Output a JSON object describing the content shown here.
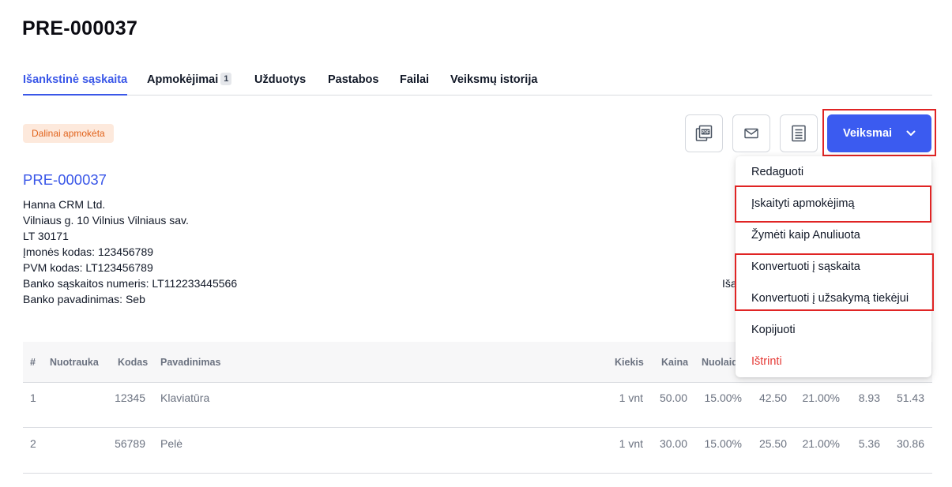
{
  "page": {
    "title": "PRE-000037"
  },
  "tabs": [
    {
      "label": "Išankstinė sąskaita",
      "active": true
    },
    {
      "label": "Apmokėjimai",
      "count": "1"
    },
    {
      "label": "Užduotys"
    },
    {
      "label": "Pastabos"
    },
    {
      "label": "Failai"
    },
    {
      "label": "Veiksmų istorija"
    }
  ],
  "status": {
    "label": "Dalinai apmokėta"
  },
  "toolbar": {
    "icons": [
      "pdf-icon",
      "mail-icon",
      "document-list-icon"
    ],
    "actions_label": "Veiksmai"
  },
  "menu": {
    "items": [
      "Redaguoti",
      "Įskaityti apmokėjimą",
      "Žymėti kaip Anuliuota",
      "Konvertuoti į sąskaita",
      "Konvertuoti į užsakymą tiekėjui",
      "Kopijuoti",
      "Ištrinti"
    ]
  },
  "document": {
    "number": "PRE-000037",
    "company": [
      "Hanna CRM Ltd.",
      "Vilniaus g. 10 Vilnius Vilniaus sav.",
      "LT 30171",
      "Įmonės kodas: 123456789",
      "PVM kodas: LT123456789",
      "Banko sąskaitos numeris: LT112233445566",
      "Banko pavadinimas: Seb"
    ],
    "partial_label": "Iša"
  },
  "table": {
    "headers": [
      "#",
      "Nuotrauka",
      "Kodas",
      "Pavadinimas",
      "Kiekis",
      "Kaina",
      "Nuolaid"
    ],
    "rows": [
      [
        "1",
        "",
        "12345",
        "Klaviatūra",
        "1 vnt",
        "50.00",
        "15.00%",
        "42.50",
        "21.00%",
        "8.93",
        "51.43"
      ],
      [
        "2",
        "",
        "56789",
        "Pelė",
        "1 vnt",
        "30.00",
        "15.00%",
        "25.50",
        "21.00%",
        "5.36",
        "30.86"
      ]
    ]
  },
  "colors": {
    "accent": "#3b5bf0",
    "danger": "#e53935",
    "badge_bg": "#fde9dc",
    "badge_text": "#e1631c",
    "highlight": "#e02424"
  }
}
